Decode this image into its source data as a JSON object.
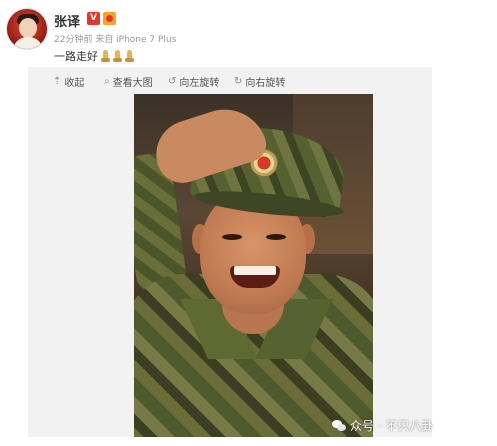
{
  "post": {
    "username": "张译",
    "verified_badge": "V",
    "meta": "22分钟前 来自 iPhone 7 Plus",
    "text": "一路走好",
    "prayer_icon_count": 3
  },
  "toolbar": {
    "collapse_label": "收起",
    "view_large_label": "查看大图",
    "rotate_left_label": "向左旋转",
    "rotate_right_label": "向右旋转"
  },
  "watermark": {
    "text": "众号 · 不只八卦"
  },
  "icons": {
    "collapse": "arrow-up-icon",
    "view_large": "magnifier-icon",
    "rotate_left": "rotate-left-icon",
    "rotate_right": "rotate-right-icon"
  },
  "colors": {
    "verified_badge": "#e8352a",
    "rank_badge": "#f6a623",
    "media_background": "#f2f2f2"
  }
}
